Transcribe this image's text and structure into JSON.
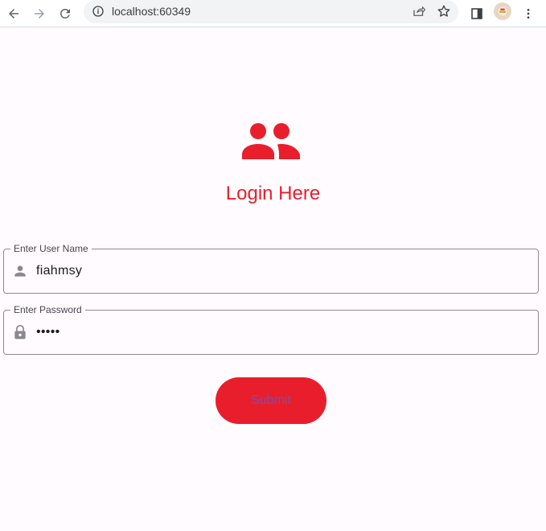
{
  "browser": {
    "url": "localhost:60349"
  },
  "page": {
    "title": "Login Here",
    "accent_color": "#e91e2d",
    "username_field": {
      "label": "Enter User Name",
      "value": "fiahmsy",
      "icon": "person-icon"
    },
    "password_field": {
      "label": "Enter Password",
      "value": "•••••",
      "icon": "lock-icon"
    },
    "submit_label": "Submit"
  }
}
